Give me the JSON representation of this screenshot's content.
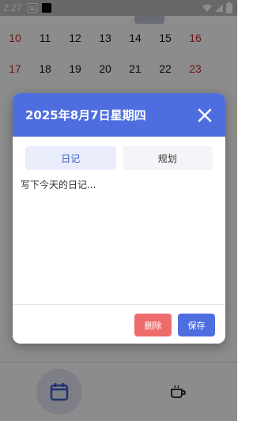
{
  "status_bar": {
    "time": "2:27"
  },
  "calendar": {
    "rows": [
      [
        "10",
        "11",
        "12",
        "13",
        "14",
        "15",
        "16"
      ],
      [
        "17",
        "18",
        "19",
        "20",
        "21",
        "22",
        "23"
      ]
    ],
    "weekend_color": "#c62828"
  },
  "dialog": {
    "title": "2025年8月7日星期四",
    "tabs": [
      {
        "label": "日记",
        "active": true
      },
      {
        "label": "规划",
        "active": false
      }
    ],
    "placeholder": "写下今天的日记...",
    "delete_label": "删除",
    "save_label": "保存",
    "accent_color": "#4e6ee0",
    "danger_color": "#ee6b6b"
  },
  "bottom_nav": {
    "items": [
      {
        "icon": "calendar-icon",
        "active": true
      },
      {
        "icon": "coffee-icon",
        "active": false
      }
    ]
  }
}
